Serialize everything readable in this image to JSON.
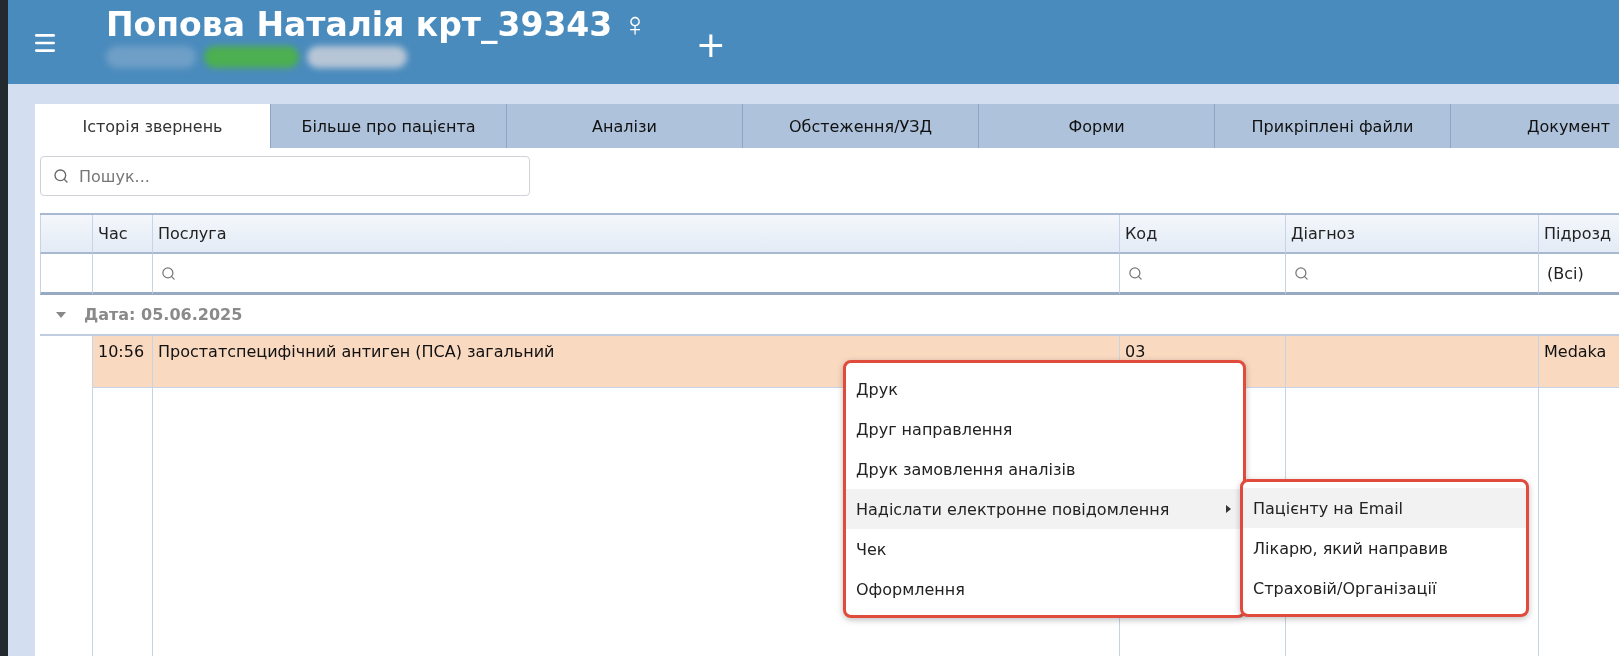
{
  "header": {
    "title": "Попова Наталія крт_39343",
    "gender_symbol": "♀",
    "add_symbol": "+"
  },
  "tabs": [
    {
      "label": "Історія звернень",
      "selected": true
    },
    {
      "label": "Більше про пацієнта",
      "selected": false
    },
    {
      "label": "Аналізи",
      "selected": false
    },
    {
      "label": "Обстеження/УЗД",
      "selected": false
    },
    {
      "label": "Форми",
      "selected": false
    },
    {
      "label": "Прикріплені файли",
      "selected": false
    },
    {
      "label": "Документ",
      "selected": false
    }
  ],
  "search": {
    "placeholder": "Пошук..."
  },
  "table": {
    "columns": [
      "Час",
      "Послуга",
      "Код",
      "Діагноз",
      "Підрозд"
    ],
    "filters": [
      {
        "kind": "none"
      },
      {
        "kind": "search"
      },
      {
        "kind": "search"
      },
      {
        "kind": "search"
      },
      {
        "kind": "value",
        "value": "(Всі)"
      }
    ],
    "groups": [
      {
        "label": "Дата: 05.06.2025",
        "expanded": true,
        "rows": [
          {
            "time": "10:56",
            "service": "Простатспецифічний антиген (ПСА) загальний",
            "code": "03",
            "unit": "Medaka",
            "selected": true
          }
        ]
      }
    ]
  },
  "context_menu": {
    "items": [
      {
        "label": "Друк",
        "has_submenu": false,
        "highlighted": false
      },
      {
        "label": "Друг направлення",
        "has_submenu": false,
        "highlighted": false
      },
      {
        "label": "Друк замовлення аналізів",
        "has_submenu": false,
        "highlighted": false
      },
      {
        "label": "Надіслати електронне повідомлення",
        "has_submenu": true,
        "highlighted": true
      },
      {
        "label": "Чек",
        "has_submenu": false,
        "highlighted": false
      },
      {
        "label": "Оформлення",
        "has_submenu": false,
        "highlighted": false
      }
    ]
  },
  "submenu": {
    "items": [
      {
        "label": "Пацієнту на Email",
        "highlighted": true
      },
      {
        "label": "Лікарю, який направив",
        "highlighted": false
      },
      {
        "label": "Страховій/Організації",
        "highlighted": false
      }
    ]
  }
}
